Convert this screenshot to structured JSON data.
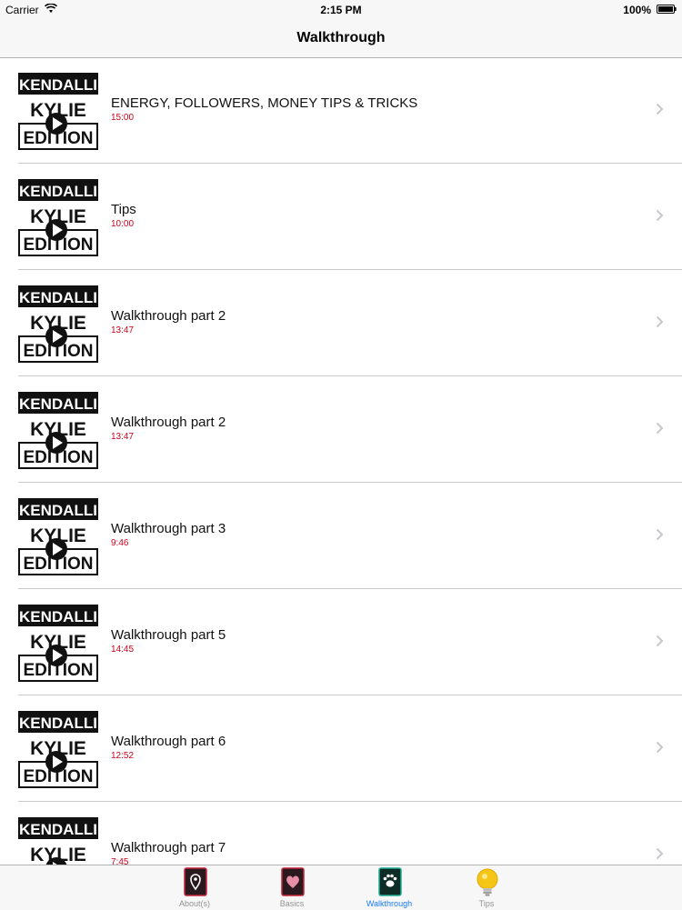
{
  "status_bar": {
    "carrier": "Carrier",
    "time": "2:15 PM",
    "battery": "100%"
  },
  "nav": {
    "title": "Walkthrough"
  },
  "thumbnail": {
    "line1": "KENDALLI",
    "line2": "KYLIE",
    "line3": "EDITION"
  },
  "rows": [
    {
      "title": "ENERGY, FOLLOWERS, MONEY TIPS & TRICKS",
      "duration": "15:00"
    },
    {
      "title": "Tips",
      "duration": "10:00"
    },
    {
      "title": "Walkthrough part 2",
      "duration": "13:47"
    },
    {
      "title": "Walkthrough part 2",
      "duration": "13:47"
    },
    {
      "title": "Walkthrough part 3",
      "duration": "9:46"
    },
    {
      "title": "Walkthrough part 5",
      "duration": "14:45"
    },
    {
      "title": "Walkthrough part 6",
      "duration": "12:52"
    },
    {
      "title": "Walkthrough part 7",
      "duration": "7:45"
    }
  ],
  "tabs": [
    {
      "label": "About(s)",
      "icon": "map-pin-icon",
      "active": false
    },
    {
      "label": "Basics",
      "icon": "heart-icon",
      "active": false
    },
    {
      "label": "Walkthrough",
      "icon": "paw-icon",
      "active": true
    },
    {
      "label": "Tips",
      "icon": "lightbulb-icon",
      "active": false
    }
  ],
  "colors": {
    "accent": "#1a7cf5",
    "duration": "#d0021b",
    "separator": "#c8c7cc"
  }
}
